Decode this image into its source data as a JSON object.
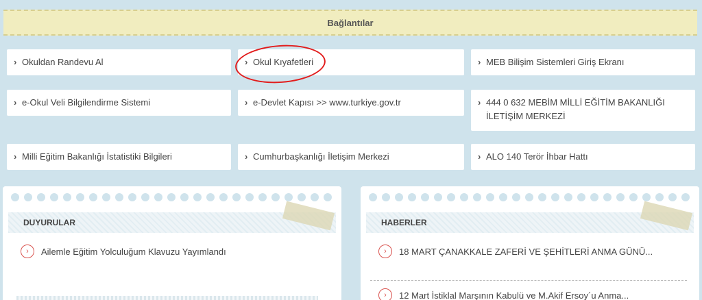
{
  "section": {
    "title": "Bağlantılar"
  },
  "links": [
    {
      "label": "Okuldan Randevu Al"
    },
    {
      "label": "Okul Kıyafetleri"
    },
    {
      "label": "MEB Bilişim Sistemleri Giriş Ekranı"
    },
    {
      "label": "e-Okul Veli Bilgilendirme Sistemi"
    },
    {
      "label": "e-Devlet Kapısı >> www.turkiye.gov.tr"
    },
    {
      "label": "444 0 632 MEBİM MİLLİ EĞİTİM BAKANLIĞI İLETİŞİM MERKEZİ"
    },
    {
      "label": "Milli Eğitim Bakanlığı İstatistiki Bilgileri"
    },
    {
      "label": "Cumhurbaşkanlığı İletişim Merkezi"
    },
    {
      "label": "ALO 140 Terör İhbar Hattı"
    }
  ],
  "announcements": {
    "title": "DUYURULAR",
    "items": [
      "Ailemle Eğitim Yolculuğum Klavuzu Yayımlandı"
    ]
  },
  "news": {
    "title": "HABERLER",
    "items": [
      "18 MART ÇANAKKALE ZAFERİ VE ŞEHİTLERİ ANMA GÜNÜ...",
      "12 Mart İstiklal Marşının Kabulü ve M.Akif Ersoy´u Anma..."
    ]
  },
  "icons": {
    "link_chevron": "chevron-right-icon",
    "item_bullet": "arrow-circle-right-icon"
  },
  "colors": {
    "highlight_ring": "#e21c1c",
    "item_icon": "#d9534f",
    "banner": "#f1edbf",
    "background": "#cfe3ec"
  }
}
